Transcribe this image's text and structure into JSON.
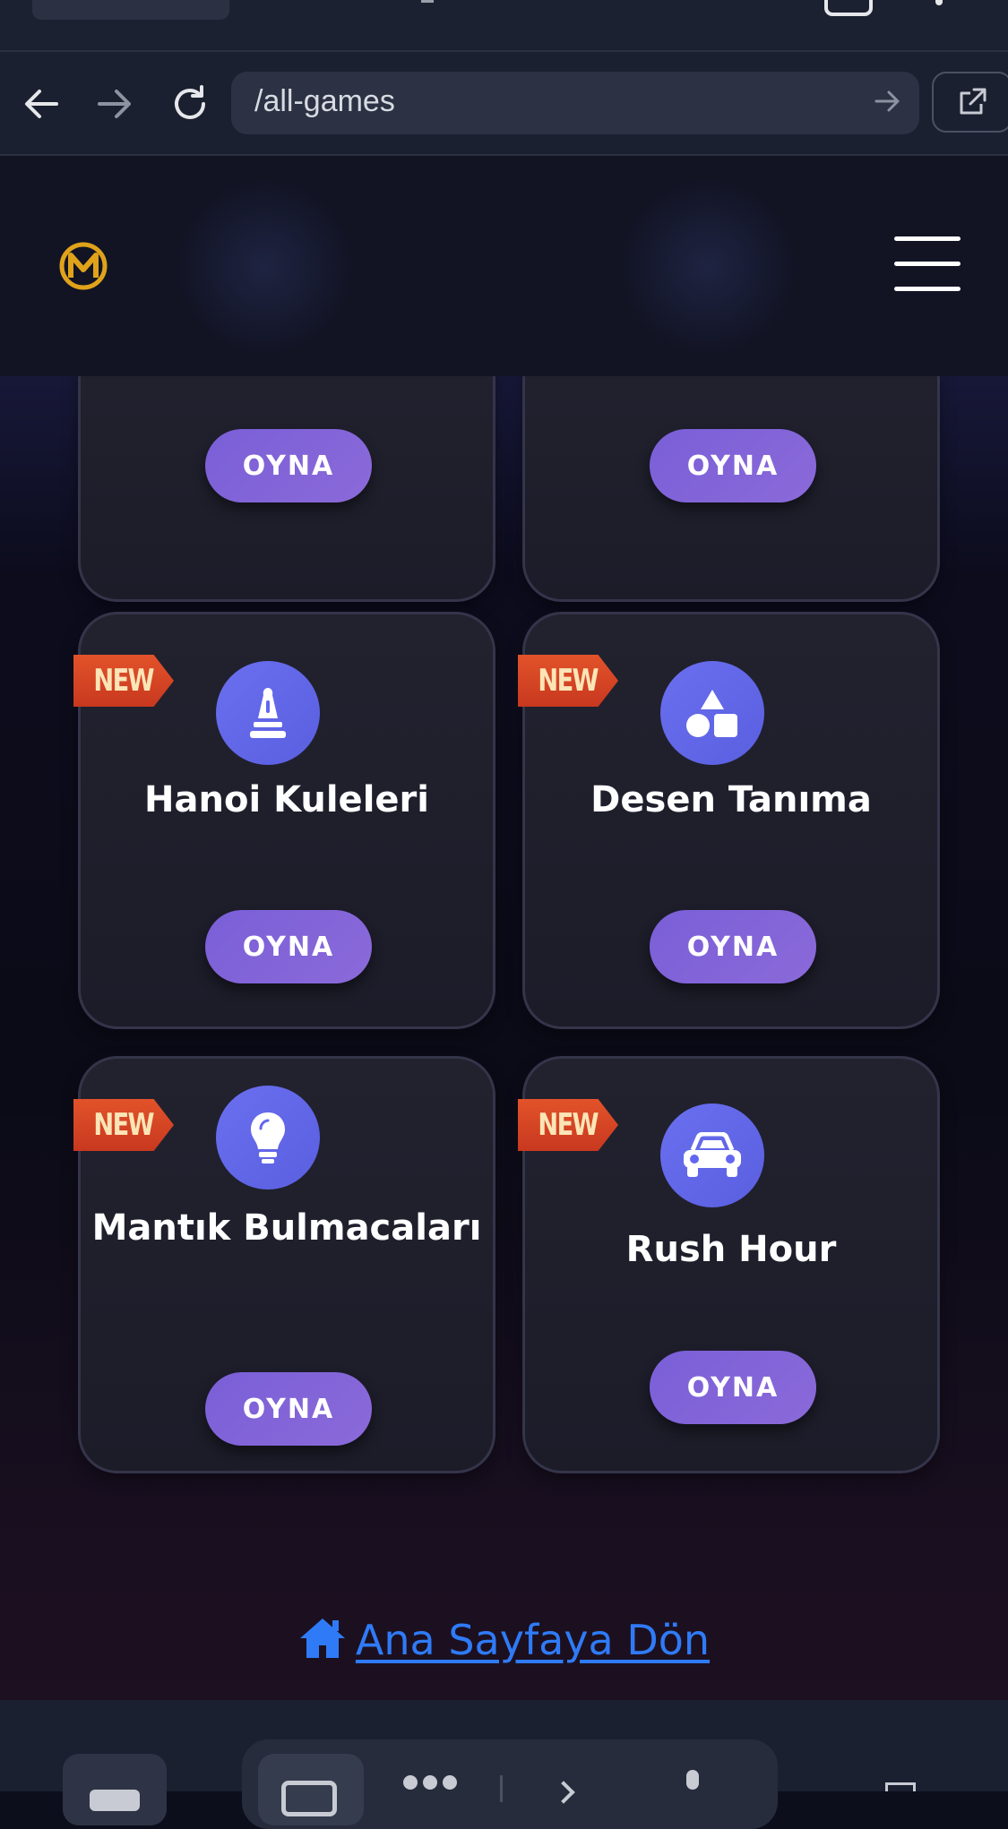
{
  "browser": {
    "url": "/all-games",
    "back_icon": "arrow-left-icon",
    "forward_icon": "arrow-right-icon",
    "reload_icon": "reload-icon",
    "go_icon": "arrow-right-icon",
    "open_external_icon": "external-link-icon"
  },
  "header": {
    "logo_icon": "logo-icon",
    "menu_icon": "hamburger-menu-icon"
  },
  "games": [
    {
      "title": "",
      "new_badge": "",
      "icon": "",
      "play_label": "OYNA"
    },
    {
      "title": "",
      "new_badge": "",
      "icon": "",
      "play_label": "OYNA"
    },
    {
      "title": "Hanoi Kuleleri",
      "new_badge": "NEW",
      "icon": "chess-piece-icon",
      "play_label": "OYNA"
    },
    {
      "title": "Desen Tanıma",
      "new_badge": "NEW",
      "icon": "shapes-icon",
      "play_label": "OYNA"
    },
    {
      "title": "Mantık Bulmacaları",
      "new_badge": "NEW",
      "icon": "lightbulb-icon",
      "play_label": "OYNA"
    },
    {
      "title": "Rush Hour",
      "new_badge": "NEW",
      "icon": "car-icon",
      "play_label": "OYNA"
    }
  ],
  "footer": {
    "home_link_label": "Ana Sayfaya Dön",
    "home_icon": "home-icon"
  },
  "colors": {
    "accent": "#7a5fd8",
    "icon_circle": "#6366f1",
    "badge": "#d9452a",
    "link": "#2f7bf7",
    "logo_gold": "#e0a21a"
  }
}
